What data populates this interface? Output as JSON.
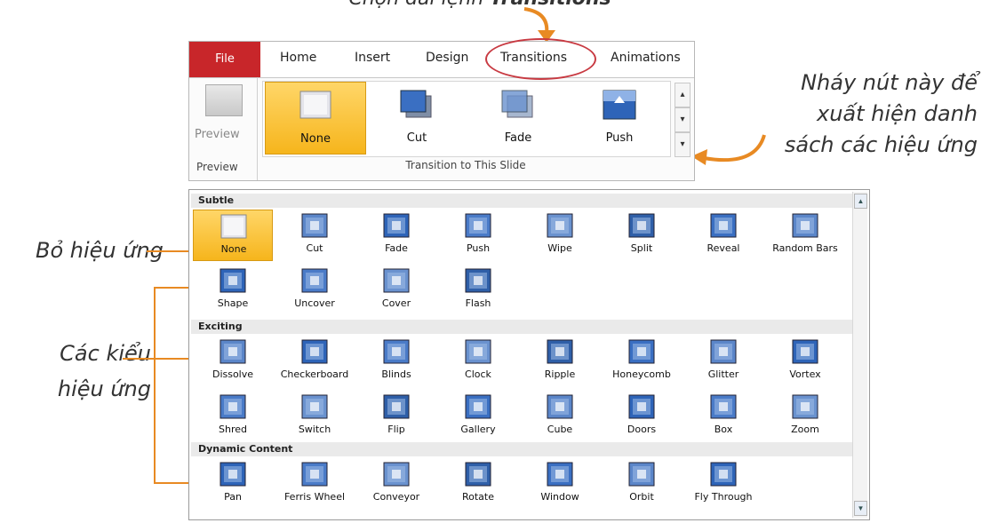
{
  "annotations": {
    "top_caption_prefix": "Chọn dải lệnh ",
    "top_caption_bold": "Transitions",
    "right_caption_lines": [
      "Nháy nút này để",
      "xuất hiện danh",
      "sách các hiệu ứng"
    ],
    "none_label": "Bỏ hiệu ứng",
    "types_label_lines": [
      "Các kiểu",
      "hiệu ứng"
    ],
    "accent_color": "#e88a23"
  },
  "ribbon": {
    "tabs": [
      "File",
      "Home",
      "Insert",
      "Design",
      "Transitions",
      "Animations"
    ],
    "active_tab": "Transitions",
    "preview_button": "Preview",
    "preview_group": "Preview",
    "gallery_items": [
      "None",
      "Cut",
      "Fade",
      "Push"
    ],
    "gallery_group": "Transition to This Slide",
    "file_tab_color": "#c8262a"
  },
  "transitions_gallery": {
    "sections": [
      {
        "title": "Subtle",
        "items": [
          "None",
          "Cut",
          "Fade",
          "Push",
          "Wipe",
          "Split",
          "Reveal",
          "Random Bars",
          "Shape",
          "Uncover",
          "Cover",
          "Flash"
        ]
      },
      {
        "title": "Exciting",
        "items": [
          "Dissolve",
          "Checkerboard",
          "Blinds",
          "Clock",
          "Ripple",
          "Honeycomb",
          "Glitter",
          "Vortex",
          "Shred",
          "Switch",
          "Flip",
          "Gallery",
          "Cube",
          "Doors",
          "Box",
          "Zoom"
        ]
      },
      {
        "title": "Dynamic Content",
        "items": [
          "Pan",
          "Ferris Wheel",
          "Conveyor",
          "Rotate",
          "Window",
          "Orbit",
          "Fly Through"
        ]
      }
    ],
    "selected_item": "None"
  }
}
